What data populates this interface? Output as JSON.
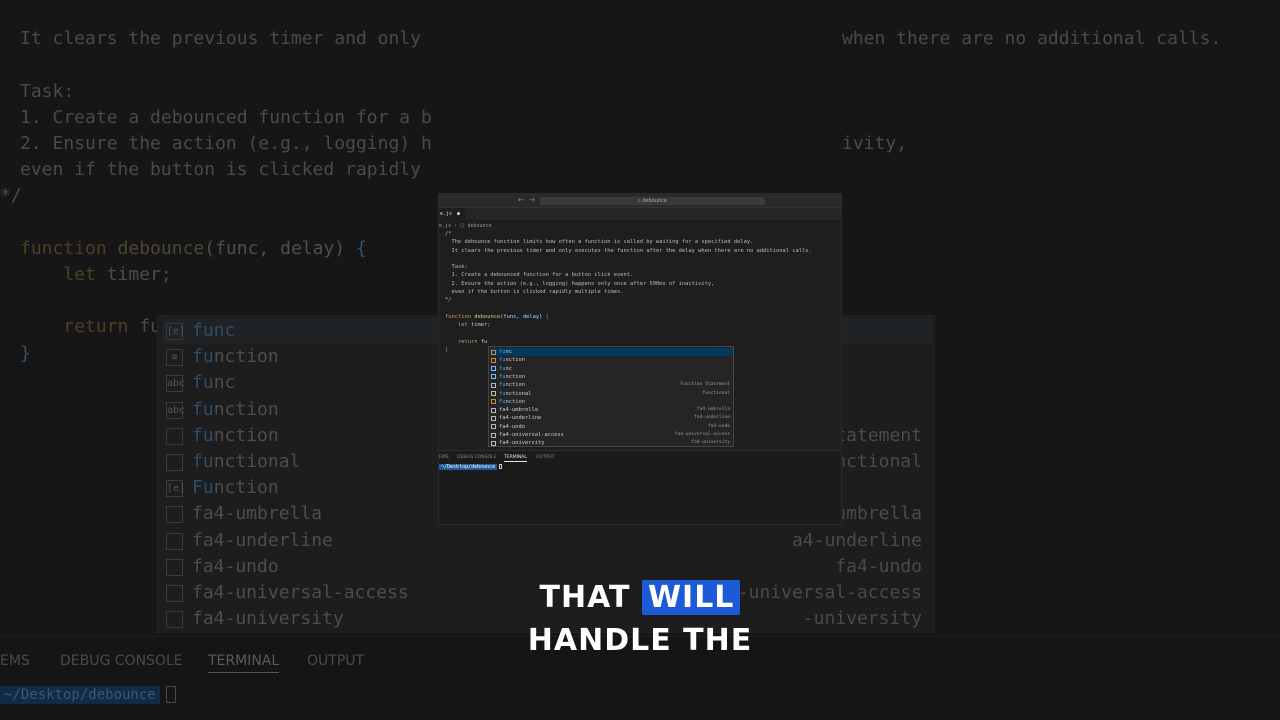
{
  "background": {
    "code_lines": [
      {
        "t": "cm",
        "s": "It clears the previous timer and only"
      },
      {
        "t": "cm",
        "s": ""
      },
      {
        "t": "cm",
        "s": "Task:"
      },
      {
        "t": "cm",
        "s": "1. Create a debounced function for a b"
      },
      {
        "t": "cm",
        "s": "2. Ensure the action (e.g., logging) h"
      },
      {
        "t": "cm",
        "s": "even if the button is clicked rapidly"
      },
      {
        "t": "cm",
        "s": "*/"
      }
    ],
    "right_text_1": "when there are no additional calls.",
    "right_text_2": "ivity,",
    "fn_line": {
      "kw": "function",
      "name": "debounce",
      "params": "(func, delay)",
      "brace": "{"
    },
    "let_line": {
      "kw": "let",
      "rest": "timer;"
    },
    "return_line": {
      "kw": "return",
      "rest": "fu"
    },
    "close_brace": "}",
    "suggestions": [
      {
        "icon": "[e]",
        "match": "func",
        "rest": "",
        "detail": ""
      },
      {
        "icon": "≡",
        "match": "fu",
        "rest": "nction",
        "detail": ""
      },
      {
        "icon": "abc",
        "match": "fu",
        "rest": "nc",
        "detail": ""
      },
      {
        "icon": "abc",
        "match": "fu",
        "rest": "nction",
        "detail": ""
      },
      {
        "icon": "",
        "match": "fu",
        "rest": "nction",
        "detail": "Statement"
      },
      {
        "icon": "",
        "match": "fu",
        "rest": "nctional",
        "detail": "unctional"
      },
      {
        "icon": "[e]",
        "match": "Fu",
        "rest": "nction",
        "detail": ""
      },
      {
        "icon": "",
        "match": "",
        "rest": "fa4-umbrella",
        "detail": "-umbrella"
      },
      {
        "icon": "",
        "match": "",
        "rest": "fa4-underline",
        "detail": "a4-underline"
      },
      {
        "icon": "",
        "match": "",
        "rest": "fa4-undo",
        "detail": "fa4-undo"
      },
      {
        "icon": "",
        "match": "",
        "rest": "fa4-universal-access",
        "detail": "-universal-access"
      },
      {
        "icon": "",
        "match": "",
        "rest": "fa4-university",
        "detail": "-university"
      }
    ],
    "panel_tabs": [
      "EMS",
      "DEBUG CONSOLE",
      "TERMINAL",
      "OUTPUT"
    ],
    "prompt_path": "~/Desktop/debounce"
  },
  "editor": {
    "search_text": "⌕ debounce",
    "nav_back": "←",
    "nav_fwd": "→",
    "tab_label": "e.js",
    "tab_dot": "●",
    "breadcrumb": "e.js  ›  ⬡ debounce",
    "code": [
      {
        "t": "cm",
        "s": "/*"
      },
      {
        "t": "cm",
        "s": "  The debounce function limits how often a function is called by waiting for a specified delay."
      },
      {
        "t": "cm",
        "s": "  It clears the previous timer and only executes the function after the delay when there are no additional calls."
      },
      {
        "t": "cm",
        "s": ""
      },
      {
        "t": "cm",
        "s": "  Task:"
      },
      {
        "t": "cm",
        "s": "  1. Create a debounced function for a button click event."
      },
      {
        "t": "cm",
        "s": "  2. Ensure the action (e.g., logging) happens only once after 500ms of inactivity,"
      },
      {
        "t": "cm",
        "s": "  even if the button is clicked rapidly multiple times."
      },
      {
        "t": "cm",
        "s": "*/"
      },
      {
        "t": "cm",
        "s": ""
      }
    ],
    "fn_line": {
      "kw": "function",
      "name": "debounce",
      "params": "(func, delay)",
      "brace": "{"
    },
    "let_line": {
      "kw": "let",
      "rest": "timer;"
    },
    "return_line": {
      "kw": "return",
      "rest": "fu"
    },
    "close_brace": "}",
    "suggestions": [
      {
        "color": "orange",
        "match": "fu",
        "rest": "nc",
        "detail": ""
      },
      {
        "color": "orange",
        "match": "fu",
        "rest": "nction",
        "detail": ""
      },
      {
        "color": "blue",
        "match": "fu",
        "rest": "nc",
        "detail": ""
      },
      {
        "color": "blue",
        "match": "fu",
        "rest": "nction",
        "detail": ""
      },
      {
        "color": "white",
        "match": "fu",
        "rest": "nction",
        "detail": "Function Statement"
      },
      {
        "color": "white",
        "match": "fu",
        "rest": "nctional",
        "detail": "functional"
      },
      {
        "color": "orange",
        "match": "Fu",
        "rest": "nction",
        "detail": ""
      },
      {
        "color": "white",
        "match": "",
        "rest": "fa4-umbrella",
        "detail": "fa4-umbrella"
      },
      {
        "color": "white",
        "match": "",
        "rest": "fa4-underline",
        "detail": "fa4-underline"
      },
      {
        "color": "white",
        "match": "",
        "rest": "fa4-undo",
        "detail": "fa4-undo"
      },
      {
        "color": "white",
        "match": "",
        "rest": "fa4-universal-access",
        "detail": "fa4-universal-access"
      },
      {
        "color": "white",
        "match": "",
        "rest": "fa4-university",
        "detail": "fa4-university"
      }
    ],
    "panel_tabs": [
      "EMS",
      "DEBUG CONSOLE",
      "TERMINAL",
      "OUTPUT"
    ],
    "prompt_path": "~/Desktop/debounce"
  },
  "caption": {
    "line1_a": "THAT",
    "line1_b": "WILL",
    "line2": "HANDLE THE"
  }
}
